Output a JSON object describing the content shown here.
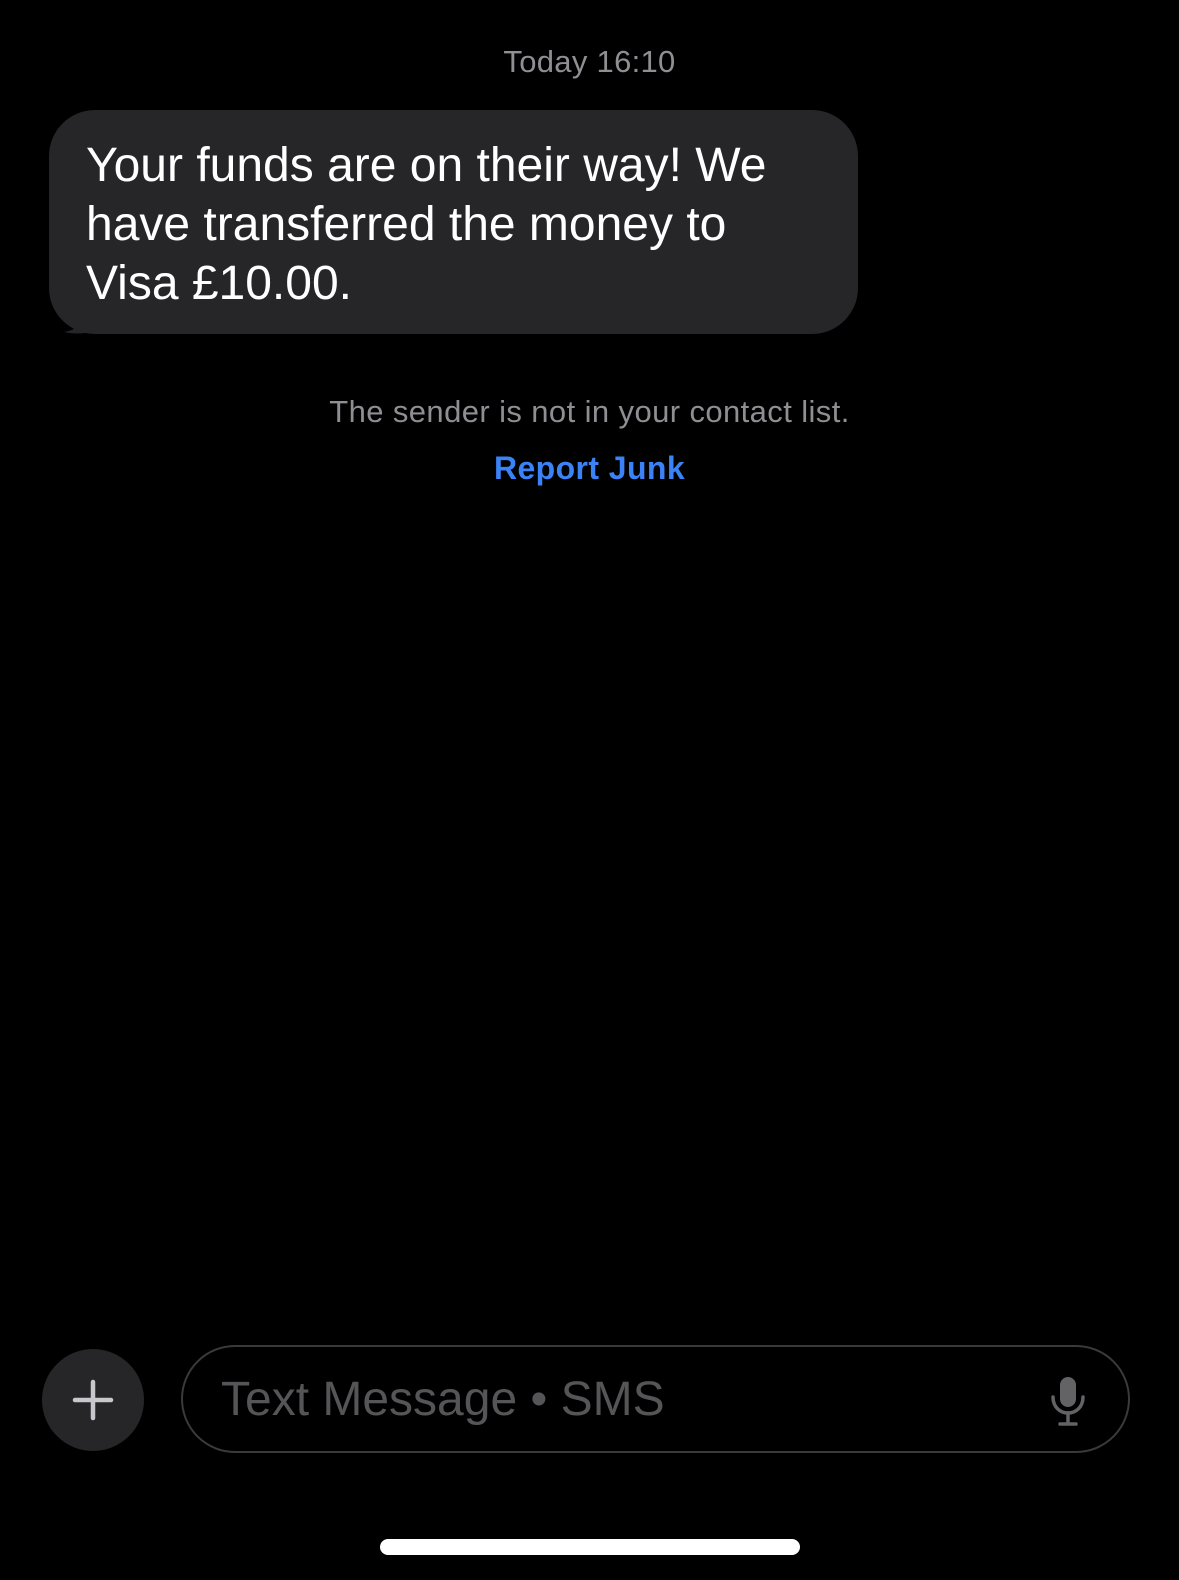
{
  "thread": {
    "timestamp": "Today 16:10",
    "messages": [
      {
        "direction": "incoming",
        "text": "Your funds are on their way! We have transferred the money to Visa £10.00."
      }
    ],
    "unknown_sender_notice": "The sender is not in your contact list.",
    "report_junk_label": "Report Junk"
  },
  "composer": {
    "placeholder": "Text Message • SMS",
    "plus_icon": "plus-icon",
    "mic_icon": "microphone-icon"
  },
  "colors": {
    "background": "#000000",
    "incoming_bubble": "#262629",
    "secondary_text": "#8e8e93",
    "link_blue": "#3b82f6",
    "placeholder_text": "#555558"
  }
}
